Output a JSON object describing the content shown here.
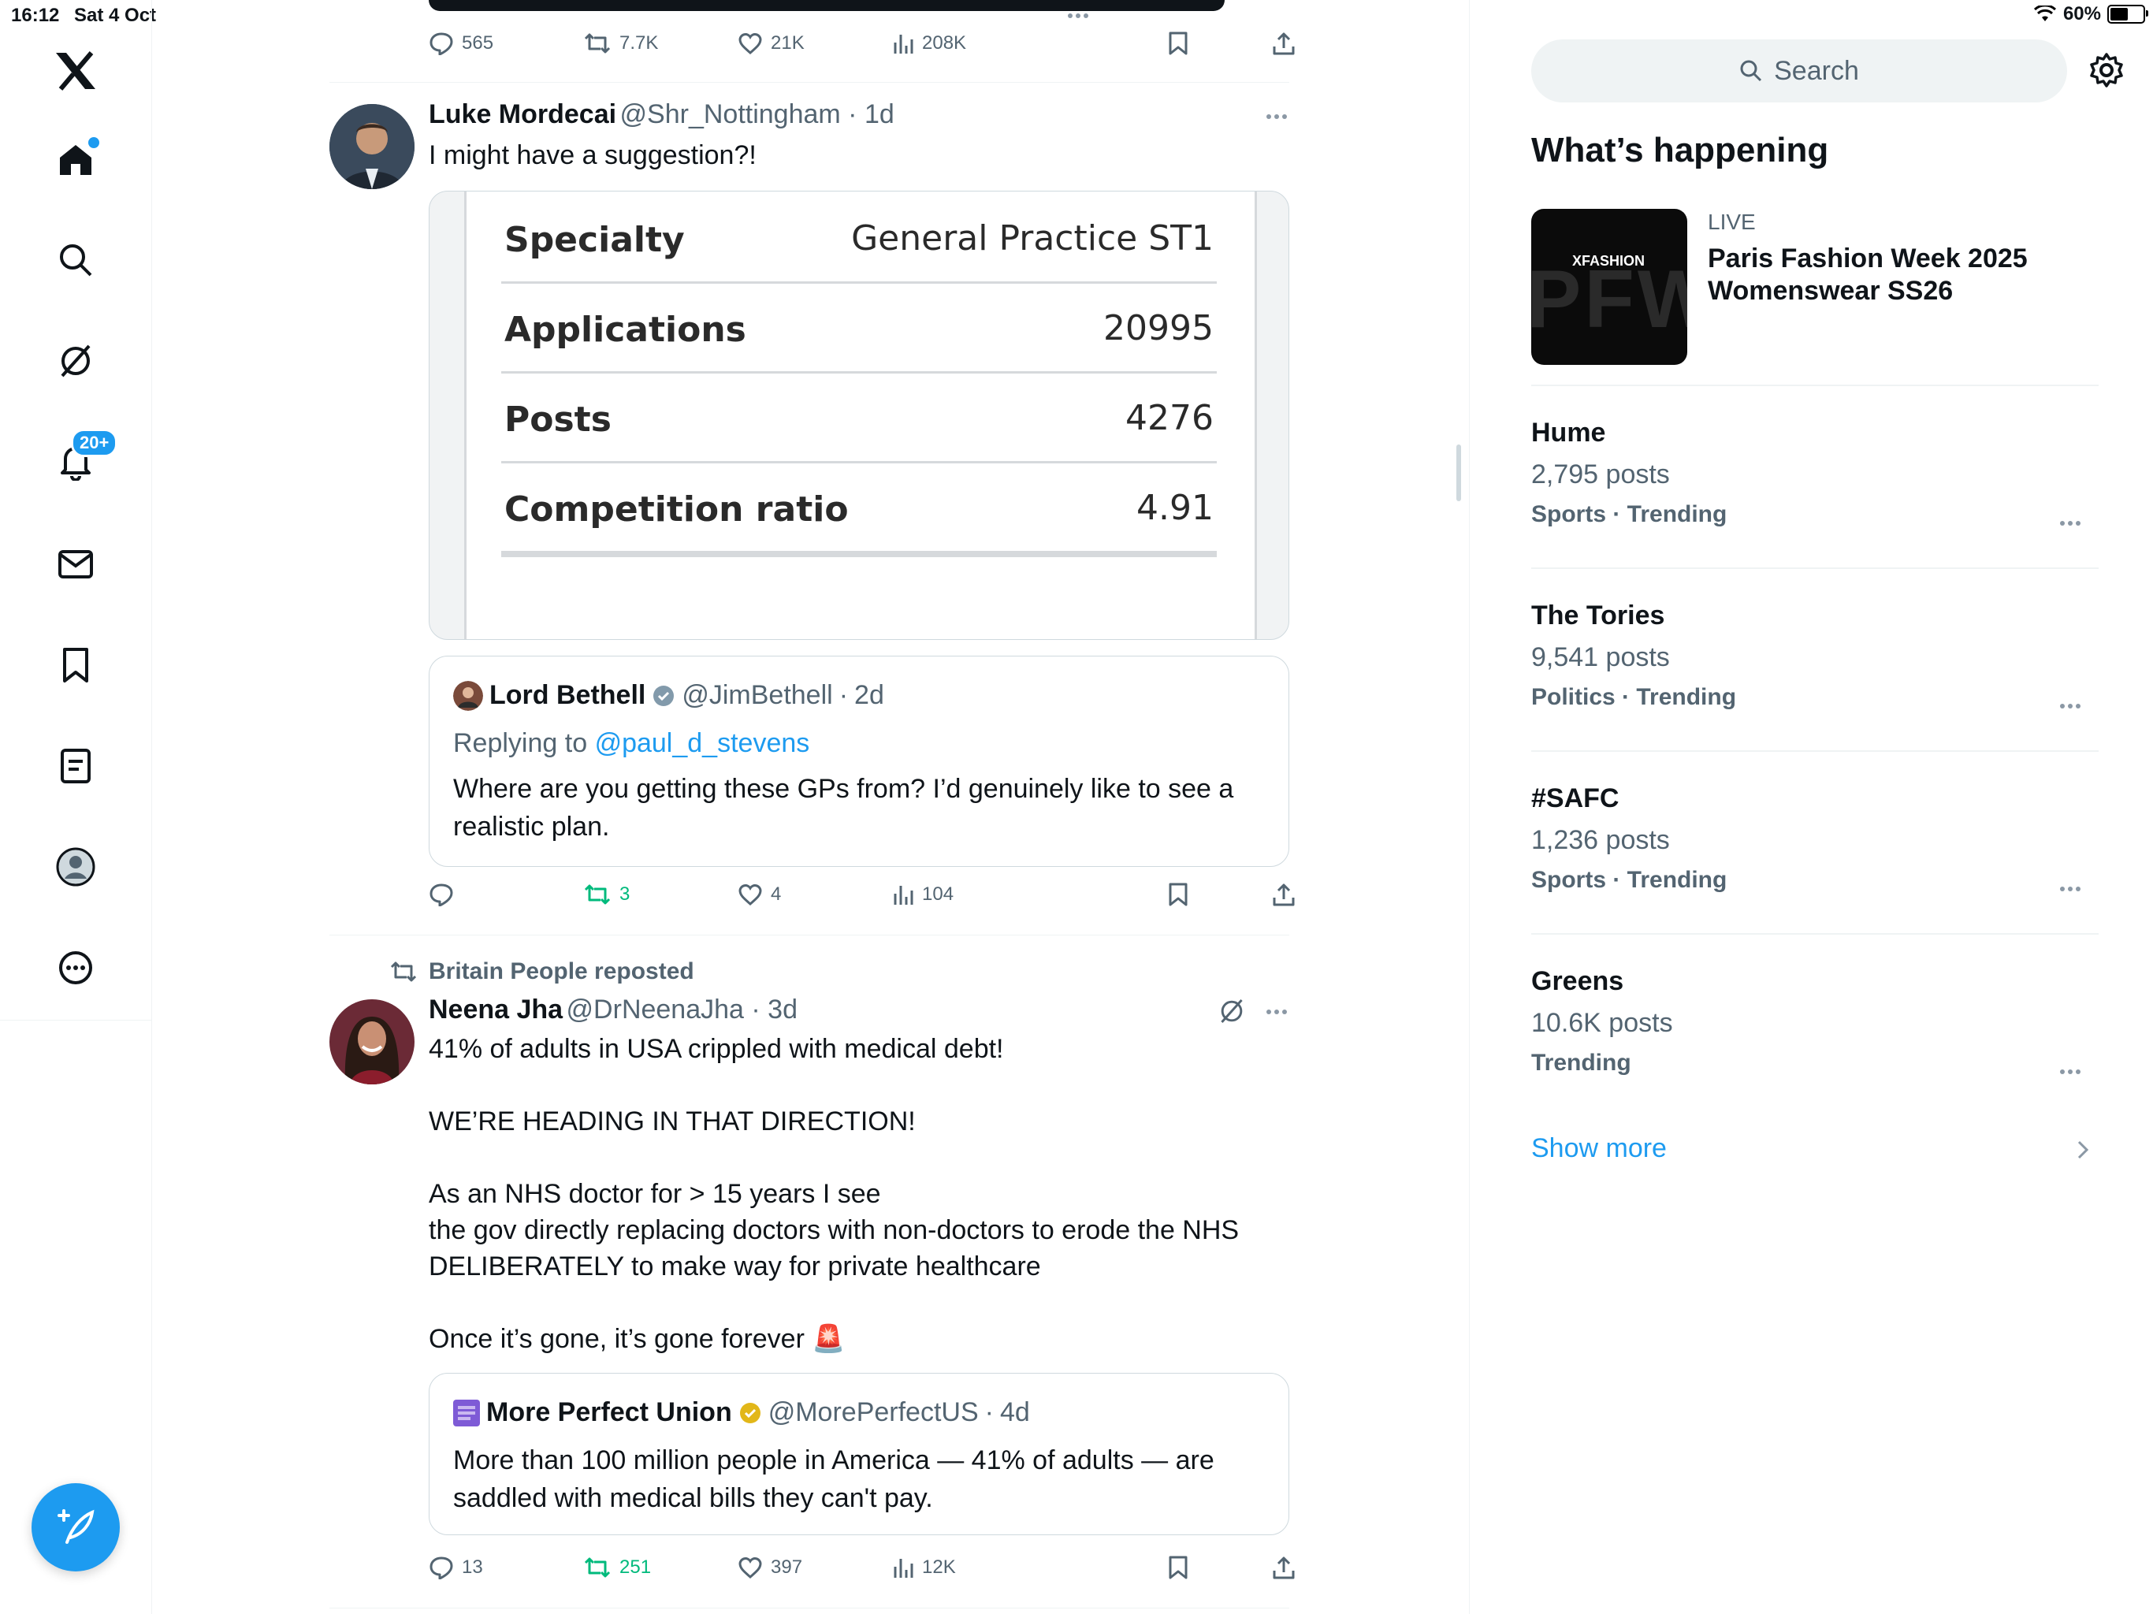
{
  "status_bar": {
    "time": "16:12",
    "date": "Sat 4 Oct",
    "battery": "60%",
    "battery_level": 0.6
  },
  "sidebar": {
    "notifications_badge": "20+"
  },
  "top_tweet": {
    "actions": {
      "replies": "565",
      "reposts": "7.7K",
      "likes": "21K",
      "views": "208K"
    }
  },
  "tweet1": {
    "name": "Luke Mordecai",
    "handle": "@Shr_Nottingham",
    "time": "1d",
    "text": "I might have a suggestion?!",
    "table": [
      {
        "key": "Specialty",
        "value": "General Practice ST1"
      },
      {
        "key": "Applications",
        "value": "20995"
      },
      {
        "key": "Posts",
        "value": "4276"
      },
      {
        "key": "Competition ratio",
        "value": "4.91"
      }
    ],
    "quote": {
      "name": "Lord Bethell",
      "handle": "@JimBethell",
      "time": "2d",
      "replying_prefix": "Replying to",
      "replying_to": "@paul_d_stevens",
      "text": "Where are you getting these GPs from? I’d genuinely like to see a realistic plan."
    },
    "actions": {
      "replies": "",
      "reposts": "3",
      "likes": "4",
      "views": "104"
    }
  },
  "tweet2": {
    "repost_label": "Britain People reposted",
    "name": "Neena Jha",
    "handle": "@DrNeenaJha",
    "time": "3d",
    "text": "41% of adults in USA crippled with medical debt!\n\nWE’RE HEADING IN THAT DIRECTION!\n\nAs an NHS doctor for > 15 years I see\nthe gov directly replacing doctors with non-doctors to erode the NHS DELIBERATELY to make way for private healthcare\n\nOnce it’s gone, it’s gone forever 🚨",
    "quote": {
      "name": "More Perfect Union",
      "handle": "@MorePerfectUS",
      "time": "4d",
      "text": "More than 100 million people in America — 41% of adults — are saddled with medical bills they can't pay."
    },
    "actions": {
      "replies": "13",
      "reposts": "251",
      "likes": "397",
      "views": "12K"
    }
  },
  "right": {
    "search_placeholder": "Search",
    "title": "What’s happening",
    "featured": {
      "label": "LIVE",
      "title": "Paris Fashion Week 2025 Womenswear SS26",
      "image_text": "XFASHION",
      "image_bg_text": "PFW"
    },
    "trends": [
      {
        "name": "Hume",
        "posts": "2,795 posts",
        "context": "Sports · Trending"
      },
      {
        "name": "The Tories",
        "posts": "9,541 posts",
        "context": "Politics · Trending"
      },
      {
        "name": "#SAFC",
        "posts": "1,236 posts",
        "context": "Sports · Trending"
      },
      {
        "name": "Greens",
        "posts": "10.6K posts",
        "context": "Trending"
      }
    ],
    "show_more": "Show more"
  },
  "colors": {
    "accent": "#1d9bf0",
    "repost_green": "#00ba7c",
    "muted": "#536471",
    "text": "#0f1419"
  }
}
